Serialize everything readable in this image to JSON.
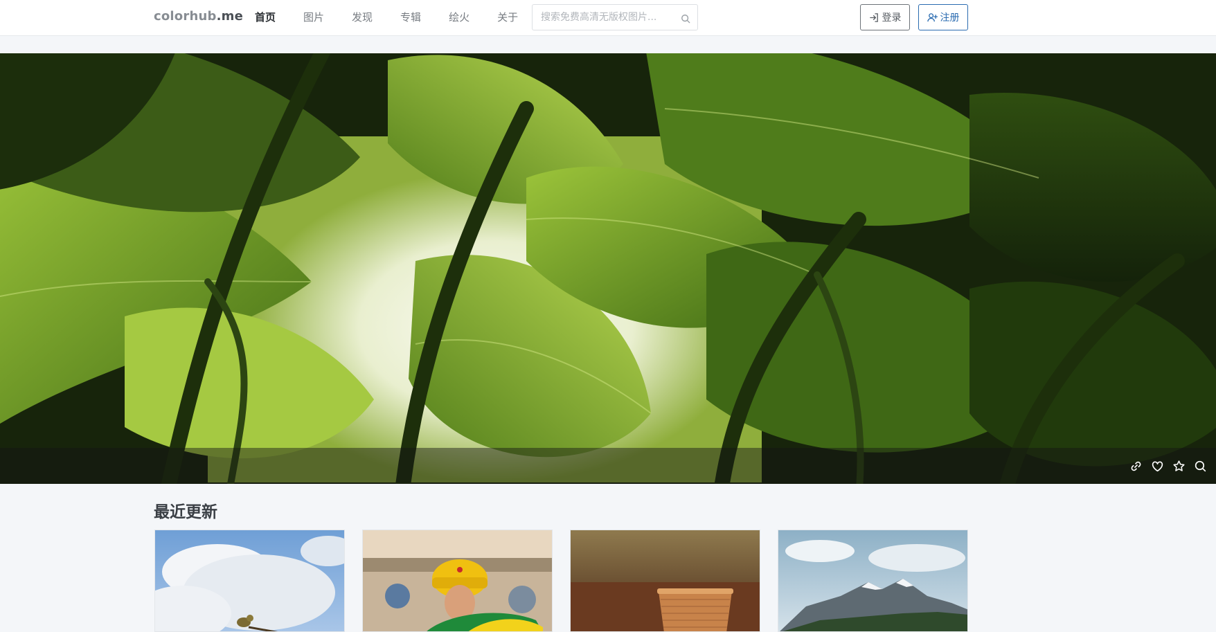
{
  "header": {
    "logo_main": "colorhub",
    "logo_tld": ".me",
    "nav": [
      "首页",
      "图片",
      "发现",
      "专辑",
      "绘火",
      "关于"
    ],
    "active_nav": "首页",
    "search": {
      "placeholder": "搜索免费高清无版权图片...",
      "value": ""
    },
    "login_label": "登录",
    "register_label": "注册"
  },
  "hero": {
    "actions": [
      "link-icon",
      "heart-icon",
      "star-icon",
      "search-icon"
    ]
  },
  "recent": {
    "title": "最近更新",
    "cards": [
      "bird on branch with cloudy sky",
      "fan in yellow hat with flag",
      "paper coffee cup",
      "snowy mountain peaks"
    ]
  },
  "colors": {
    "accent": "#2a6bb0",
    "page_bg": "#f4f6f9",
    "leaf_green": "#6f9a1e"
  }
}
